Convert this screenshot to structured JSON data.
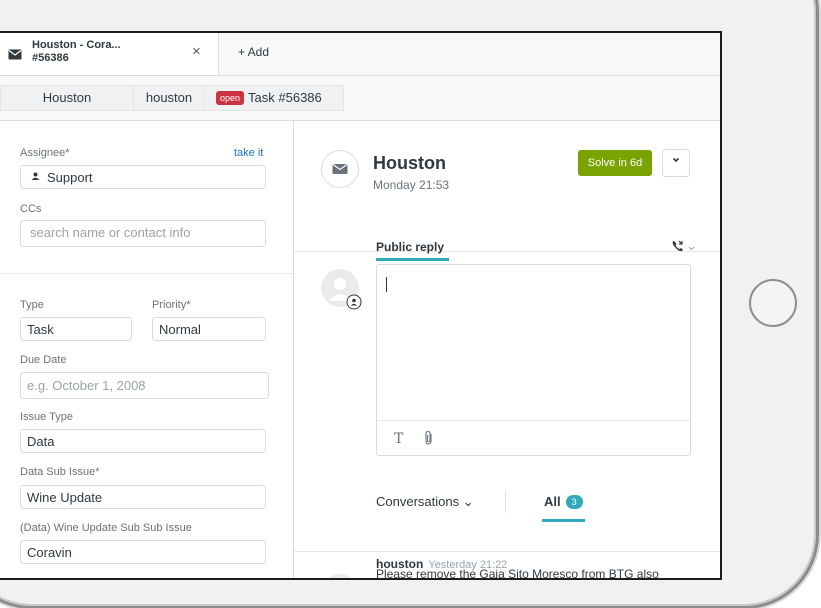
{
  "tab": {
    "title_line1": "Houston - Cora...",
    "title_line2": "#56386",
    "close": "×",
    "add": "+ Add"
  },
  "breadcrumb": {
    "org": "Houston",
    "user": "houston",
    "status": "open",
    "ticket": "Task #56386"
  },
  "sidebar": {
    "assignee_label": "Assignee*",
    "take_it": "take it",
    "assignee_value": "Support",
    "ccs_label": "CCs",
    "ccs_placeholder": "search name or contact info",
    "type_label": "Type",
    "type_value": "Task",
    "priority_label": "Priority*",
    "priority_value": "Normal",
    "due_label": "Due Date",
    "due_placeholder": "e.g. October 1, 2008",
    "issue_type_label": "Issue Type",
    "issue_type_value": "Data",
    "sub_issue_label": "Data Sub Issue*",
    "sub_issue_value": "Wine Update",
    "sub_sub_label": "(Data) Wine Update Sub Sub Issue",
    "sub_sub_value": "Coravin"
  },
  "ticket": {
    "subject": "Houston",
    "time": "Monday 21:53",
    "solve_button": "Solve in 6d",
    "dropdown": "⌄"
  },
  "reply": {
    "tab_label": "Public reply",
    "format_tool": "T"
  },
  "conversations": {
    "filter_label": "Conversations ⌄",
    "all_label": "All",
    "all_count": "3"
  },
  "comment": {
    "author": "houston",
    "time": "Yesterday 21:22",
    "preview": "Please remove the Gaia Sito Moresco from BTG also"
  },
  "colors": {
    "solve_green": "#78a300",
    "accent_teal": "#30aabc",
    "open_red": "#cc3340",
    "link_blue": "#1f73b7"
  }
}
